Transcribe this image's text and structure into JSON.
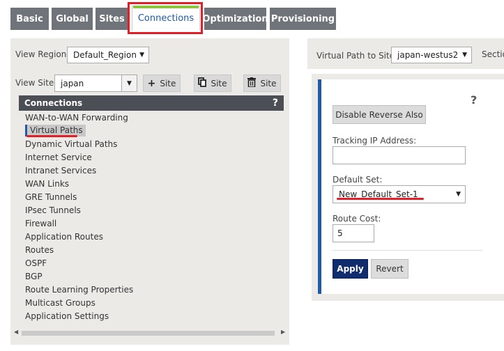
{
  "tabs": [
    {
      "label": "Basic"
    },
    {
      "label": "Global"
    },
    {
      "label": "Sites"
    },
    {
      "label": "Connections"
    },
    {
      "label": "Optimization"
    },
    {
      "label": "Provisioning"
    }
  ],
  "left": {
    "view_region_label": "View Region:",
    "view_region_value": "Default_Region",
    "view_site_label": "View Site:",
    "view_site_value": "japan",
    "add_site_label": "Site",
    "clone_site_label": "Site",
    "delete_site_label": "Site",
    "connections_header": "Connections",
    "help_glyph": "?",
    "menu_items": [
      "WAN-to-WAN Forwarding",
      "Virtual Paths",
      "Dynamic Virtual Paths",
      "Internet Service",
      "Intranet Services",
      "WAN Links",
      "GRE Tunnels",
      "IPsec Tunnels",
      "Firewall",
      "Application Routes",
      "Routes",
      "OSPF",
      "BGP",
      "Route Learning Properties",
      "Multicast Groups",
      "Application Settings"
    ],
    "selected_item": "Virtual Paths"
  },
  "right": {
    "virtual_path_label": "Virtual Path to Site:",
    "virtual_path_value": "japan-westus2",
    "section_label": "Sectio",
    "help_glyph": "?",
    "disable_reverse_label": "Disable Reverse Also",
    "tracking_ip_label": "Tracking IP Address:",
    "tracking_ip_value": "",
    "default_set_label": "Default Set:",
    "default_set_value": "New_Default_Set-1",
    "route_cost_label": "Route Cost:",
    "route_cost_value": "5",
    "apply_label": "Apply",
    "revert_label": "Revert"
  },
  "colors": {
    "accent_blue": "#1f5aa6",
    "apply_navy": "#102c6e",
    "highlight_red": "#e21e26",
    "active_tab_green": "#8cc63f",
    "tab_gray": "#6f747a"
  },
  "icons": {
    "add": "plus-icon",
    "clone": "copy-icon",
    "delete": "trash-icon",
    "dropdown": "chevron-down-icon"
  }
}
